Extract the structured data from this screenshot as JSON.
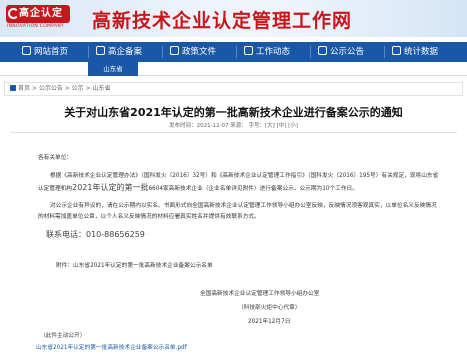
{
  "header": {
    "logo_text": "高企认定",
    "logo_sub": "INNOVATION COMPANY",
    "site_title": "高新技术企业认定管理工作网"
  },
  "nav": {
    "items": [
      {
        "label": "网站首页",
        "icon": "home-icon"
      },
      {
        "label": "高企备案",
        "icon": "document-icon"
      },
      {
        "label": "政策文件",
        "icon": "folder-icon"
      },
      {
        "label": "工作动态",
        "icon": "news-icon"
      },
      {
        "label": "公示公告",
        "icon": "bell-icon"
      },
      {
        "label": "统计数据",
        "icon": "chart-icon"
      }
    ]
  },
  "subtab": {
    "label": "山东省"
  },
  "breadcrumb": {
    "text": "首页 > 公示公告 > 公示 > 山东省"
  },
  "article": {
    "title": "关于对山东省2021年认定的第一批高新技术企业进行备案公示的通知",
    "meta": "发布时间：2021-12-07  来源：    字号：[大] [中] [小]",
    "salutation": "各有关单位：",
    "para1_line1": "根据《高新技术企业认定管理办法》（国科发火〔2016〕32号）和《高新技术企业认定管理工作指引》（国科发火〔2016〕195号）有关规定，现将山东省",
    "para1_line2_pre": "认定管理机构",
    "para1_line2_mid": "2021年认定的第一批",
    "para1_line2_post": "6604家高新技术企业（企业名单详见附件）进行备案公示，公示期为10个工作日。",
    "para2_line1": "对公示企业有异议的，请在公示期内以实名、书面形式向全国高新技术企业认定管理工作领导小组办公室反映，反映情况须客观真实，以单位名义反映情况",
    "para2_line2": "的材料需加盖单位公章，以个人名义反映情况的材料应署真实姓名并提供有效联系方式。",
    "phone": "联系电话：010-88656259",
    "attachment": "附件：山东省2021年认定的第一批高新技术企业备案公示名单",
    "sign_org": "全国高新技术企业认定管理工作领导小组办公室",
    "sign_sub": "（科技部火炬中心代章）",
    "sign_date": "2021年12月7日",
    "note": "（此件主动公开）",
    "file_link": "山东省2021年认定的第一批高新技术企业备案公示名单.pdf"
  }
}
